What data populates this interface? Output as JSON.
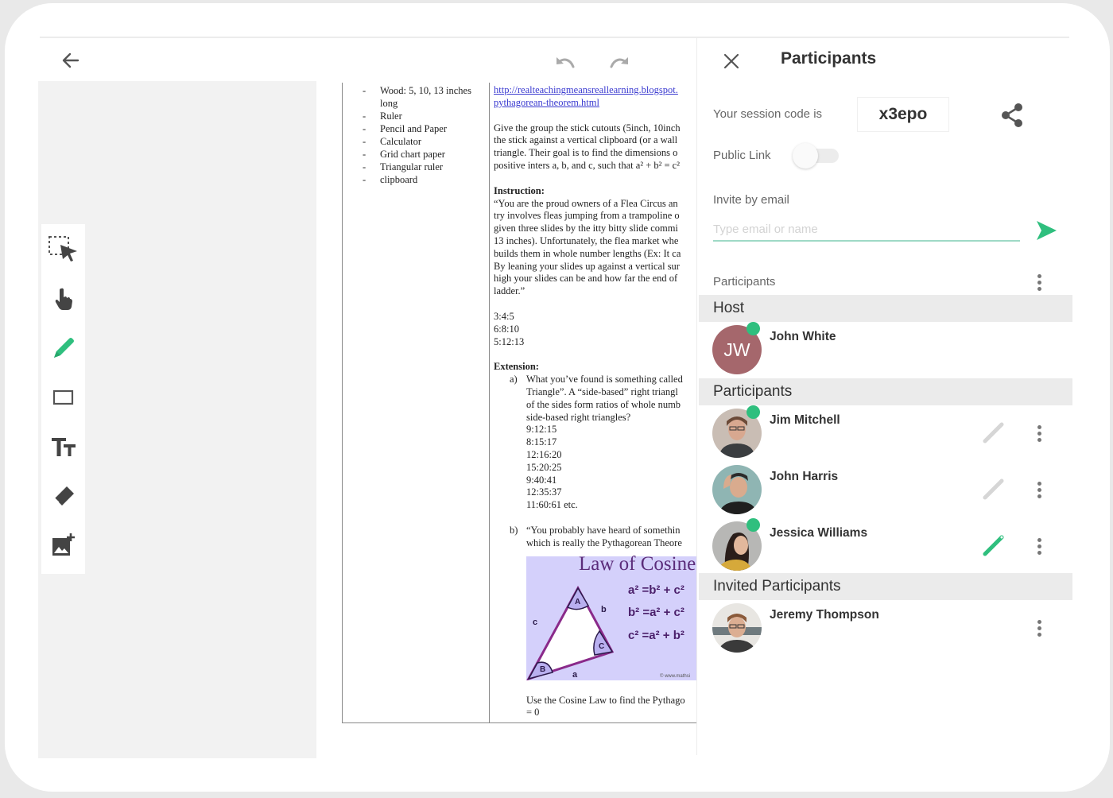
{
  "toolbar_top": {
    "back_icon": "arrow-left-icon",
    "undo_icon": "undo-icon",
    "redo_icon": "redo-icon"
  },
  "tools": [
    {
      "name": "select",
      "icon": "select-arrow-icon",
      "active": false
    },
    {
      "name": "pan",
      "icon": "hand-pointer-icon",
      "active": false
    },
    {
      "name": "pencil",
      "icon": "pencil-icon",
      "active": true
    },
    {
      "name": "rectangle",
      "icon": "rectangle-icon",
      "active": false
    },
    {
      "name": "text",
      "icon": "text-size-icon",
      "active": false
    },
    {
      "name": "eraser",
      "icon": "eraser-icon",
      "active": false
    },
    {
      "name": "add-image",
      "icon": "add-image-icon",
      "active": false
    }
  ],
  "colors": {
    "accent": "#2fbf7e",
    "host_avatar": "#a5676c",
    "section_bg": "#ebebeb",
    "link": "#3a3ad0",
    "cos_bg": "#d4d0fb"
  },
  "document": {
    "materials": [
      "Wood:  5, 10, 13 inches long",
      "Ruler",
      "Pencil and Paper",
      "Calculator",
      "Grid chart paper",
      "Triangular ruler",
      "clipboard"
    ],
    "link_line1": "http://realteachingmeansreallearning.blogspot.",
    "link_line2": "pythagorean-theorem.html",
    "intro_lines": [
      "Give the group the stick cutouts (5inch, 10inch",
      "the stick against a vertical clipboard (or a wall",
      "triangle. Their goal is to find the dimensions o",
      "positive inters a, b, and c, such that a² + b² = c²"
    ],
    "instruction_heading": "Instruction:",
    "instruction_lines": [
      "“You are the proud owners of a Flea Circus an",
      "try involves fleas jumping from a trampoline o",
      "given three slides by the itty bitty slide commi",
      "13 inches). Unfortunately, the flea market whe",
      "builds them in whole number lengths (Ex: It ca",
      "By leaning your slides up against a vertical sur",
      "high your slides can be and how far the end of",
      "ladder.”"
    ],
    "ratios": [
      "3:4:5",
      "6:8:10",
      "5:12:13"
    ],
    "extension_heading": "Extension:",
    "ext_a_label": "a)",
    "ext_a_lines": [
      "What you’ve found is something called",
      "Triangle”.  A “side-based” right triangl",
      "of the sides form ratios of whole numb",
      "side-based right triangles?",
      "9:12:15",
      "8:15:17",
      "12:16:20",
      "15:20:25",
      "9:40:41",
      "12:35:37",
      "11:60:61 etc."
    ],
    "ext_b_label": "b)",
    "ext_b_lines": [
      "“You probably have heard of somethin",
      "which is really the Pythagorean Theore"
    ],
    "cosine_image": {
      "title": "Law of Cosines",
      "eq1": "a² =b²  + c²",
      "eq2": "b² =a²  + c²",
      "eq3": "c² =a²  + b²",
      "vertex_a": "A",
      "vertex_b": "B",
      "vertex_c": "C",
      "side_a": "a",
      "side_b": "b",
      "side_c": "c",
      "credit": "© www.mathsi"
    },
    "footer_lines": [
      "Use the Cosine Law to find the Pythago",
      "= 0"
    ]
  },
  "panel": {
    "title": "Participants",
    "close_icon": "close-icon",
    "session_label": "Your session code is",
    "session_code": "x3epo",
    "share_icon": "share-icon",
    "public_link_label": "Public Link",
    "public_link_on": false,
    "invite_label": "Invite by email",
    "invite_placeholder": "Type email or name",
    "invite_value": "",
    "send_icon": "send-icon",
    "participants_label": "Participants",
    "host_section": "Host",
    "participants_section": "Participants",
    "invited_section": "Invited Participants",
    "host": {
      "name": "John White",
      "initials": "JW",
      "online": true
    },
    "participants": [
      {
        "name": "Jim Mitchell",
        "online": true,
        "can_draw": false
      },
      {
        "name": "John Harris",
        "online": false,
        "can_draw": false
      },
      {
        "name": "Jessica Williams",
        "online": true,
        "can_draw": true
      }
    ],
    "invited": [
      {
        "name": "Jeremy Thompson"
      }
    ]
  }
}
